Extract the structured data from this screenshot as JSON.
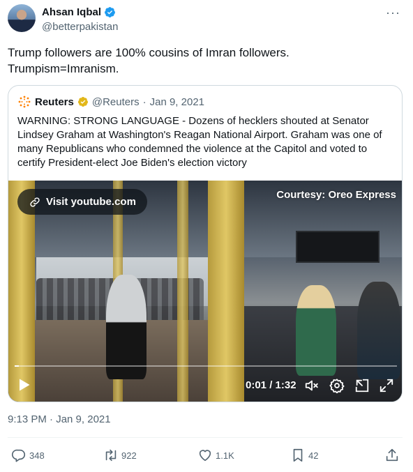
{
  "tweet": {
    "author_name": "Ahsan Iqbal",
    "author_handle": "@betterpakistan",
    "text": "Trump followers are 100% cousins of Imran followers.\nTrumpism=Imranism.",
    "timestamp": "9:13 PM · Jan 9, 2021",
    "more_label": "···"
  },
  "quoted": {
    "author_name": "Reuters",
    "author_handle": "@Reuters",
    "separator": "·",
    "date": "Jan 9, 2021",
    "text": "WARNING: STRONG LANGUAGE - Dozens of hecklers shouted at Senator Lindsey Graham at Washington's Reagan National Airport. Graham was one of many Republicans who condemned the violence at the Capitol and voted to certify President-elect Joe Biden's election victory"
  },
  "video": {
    "visit_label": "Visit youtube.com",
    "courtesy_text": "Courtesy: Oreo Express",
    "time_display": "0:01 / 1:32",
    "progress_fraction": 0.011
  },
  "actions": {
    "replies": "348",
    "retweets": "922",
    "likes": "1.1K",
    "bookmarks": "42"
  },
  "icons": {
    "verified": "verified-badge-icon",
    "reuters_logo": "reuters-logo-icon",
    "link": "link-icon",
    "play": "play-icon",
    "mute": "mute-icon",
    "settings": "gear-icon",
    "pip": "pip-icon",
    "fullscreen": "fullscreen-icon",
    "reply": "reply-icon",
    "retweet": "retweet-icon",
    "like": "heart-icon",
    "bookmark": "bookmark-icon",
    "share": "share-icon"
  },
  "colors": {
    "verified_blue": "#1d9bf0",
    "verified_gold": "#e2b719",
    "secondary_text": "#536471",
    "reuters_orange": "#ff8000"
  }
}
